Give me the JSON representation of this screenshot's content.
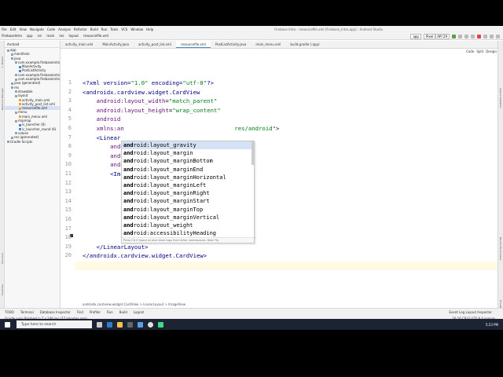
{
  "window": {
    "title": "Firebase Intro - resourcefile.xml [Firebase_Intro.app] - Android Studio",
    "menu": [
      "File",
      "Edit",
      "View",
      "Navigate",
      "Code",
      "Analyze",
      "Refactor",
      "Build",
      "Run",
      "Tools",
      "VCS",
      "Window",
      "Help"
    ]
  },
  "nav": {
    "breadcrumbs": [
      "FirebaseIntro",
      "app",
      "src",
      "main",
      "res",
      "layout",
      "resourcefile.xml"
    ],
    "config": "app",
    "device": "Pixel 2 API 29"
  },
  "project_panel": {
    "view": "Android",
    "items": [
      {
        "label": "app",
        "indent": 0
      },
      {
        "label": "manifests",
        "indent": 1
      },
      {
        "label": "java",
        "indent": 1
      },
      {
        "label": "com.example.firebaseintro",
        "indent": 2
      },
      {
        "label": "MainActivity",
        "indent": 3
      },
      {
        "label": "PostListActivity",
        "indent": 3
      },
      {
        "label": "com.example.firebaseintro",
        "indent": 2
      },
      {
        "label": "com.example.firebaseintro",
        "indent": 2
      },
      {
        "label": "java (generated)",
        "indent": 1
      },
      {
        "label": "res",
        "indent": 1
      },
      {
        "label": "drawable",
        "indent": 2
      },
      {
        "label": "layout",
        "indent": 2
      },
      {
        "label": "activity_main.xml",
        "indent": 3
      },
      {
        "label": "activity_post_list.xml",
        "indent": 3
      },
      {
        "label": "resourcefile.xml",
        "indent": 3
      },
      {
        "label": "menu",
        "indent": 2
      },
      {
        "label": "main_menu.xml",
        "indent": 3
      },
      {
        "label": "mipmap",
        "indent": 2
      },
      {
        "label": "ic_launcher (6)",
        "indent": 3
      },
      {
        "label": "ic_launcher_round (6)",
        "indent": 3
      },
      {
        "label": "values",
        "indent": 2
      },
      {
        "label": "res (generated)",
        "indent": 1
      },
      {
        "label": "Gradle Scripts",
        "indent": 0
      }
    ]
  },
  "tabs": [
    "activity_main.xml",
    "MainActivity.java",
    "activity_post_list.xml",
    "resourcefile.xml",
    "PostListActivity.java",
    "main_menu.xml",
    "build.gradle (:app)"
  ],
  "active_tab": 3,
  "view_modes": [
    "Code",
    "Split",
    "Design"
  ],
  "code_lines": [
    {
      "n": "1",
      "html": "<span class='pi'>&lt;?xml version=<span class='val'>\"1.0\"</span> encoding=<span class='val'>\"utf-8\"</span>?&gt;</span>"
    },
    {
      "n": "2",
      "html": "<span class='tag'>&lt;androidx.cardview.widget.CardView</span>"
    },
    {
      "n": "3",
      "html": "    <span class='attr'>android:layout_width</span>=<span class='val'>\"match_parent\"</span>"
    },
    {
      "n": "4",
      "html": "    <span class='attr'>android:layout_height</span>=<span class='val'>\"wrap_content\"</span>"
    },
    {
      "n": "5",
      "html": "    <span class='attr'>android</span>"
    },
    {
      "n": "6",
      "html": "    <span class='attr'>xmlns:an</span>                                <span class='val'>res/android\"</span><span class='tag'>&gt;</span>"
    },
    {
      "n": "7",
      "html": "    <span class='tag'>&lt;Linear</span>"
    },
    {
      "n": "8",
      "html": "        <span class='attr'>andr</span>"
    },
    {
      "n": "9",
      "html": "        <span class='attr'>andr</span>"
    },
    {
      "n": "10",
      "html": "        <span class='attr'>andr</span>"
    },
    {
      "n": "11",
      "html": "        <span class='tag'>&lt;Ima</span>"
    },
    {
      "n": "12",
      "html": ""
    },
    {
      "n": "13",
      "html": ""
    },
    {
      "n": "14",
      "html": ""
    },
    {
      "n": "15",
      "html": "                                       <span class='val'>ground\"</span>"
    },
    {
      "n": "16",
      "html": "            <span class='attr'>and</span>"
    },
    {
      "n": "17",
      "html": "            <span class='attr'>android:layout_width</span>=<span class='val'>\"match_parent\"</span>"
    },
    {
      "n": "18",
      "html": "            <span class='attr'>android:layout_height</span>=<span class='val'>\"wrap_content\"</span><span class='tag'>/&gt;</span>"
    },
    {
      "n": "19",
      "html": "    <span class='tag'>&lt;/LinearLayout&gt;</span>"
    },
    {
      "n": "20",
      "html": "<span class='tag'>&lt;/androidx.cardview.widget.CardView&gt;</span>"
    }
  ],
  "autocomplete": {
    "items": [
      "android:layout_gravity",
      "android:layout_margin",
      "android:layout_marginBottom",
      "android:layout_marginEnd",
      "android:layout_marginHorizontal",
      "android:layout_marginLeft",
      "android:layout_marginRight",
      "android:layout_marginStart",
      "android:layout_marginTop",
      "android:layout_marginVertical",
      "android:layout_weight",
      "android:accessibilityHeading"
    ],
    "footer": "Press Ctrl+Space to also show tags from other namespaces. Next Tip"
  },
  "breadcrumb_path": "androidx.cardview.widget.CardView  >  LinearLayout  >  ImageView",
  "bottom_tools": [
    "TODO",
    "Terminal",
    "Database Inspector",
    "Find",
    "Profiler",
    "Run",
    "Build",
    "Logcat"
  ],
  "bottom_right": [
    "Event Log",
    "Layout Inspector"
  ],
  "status": {
    "message": "Gradle sync finished in 7 s 146 ms (27 minutes ago)",
    "right": "16:16   CRLF   UTF-8   4 spaces"
  },
  "taskbar": {
    "search_placeholder": "Type here to search",
    "clock": "5:23 PM"
  }
}
